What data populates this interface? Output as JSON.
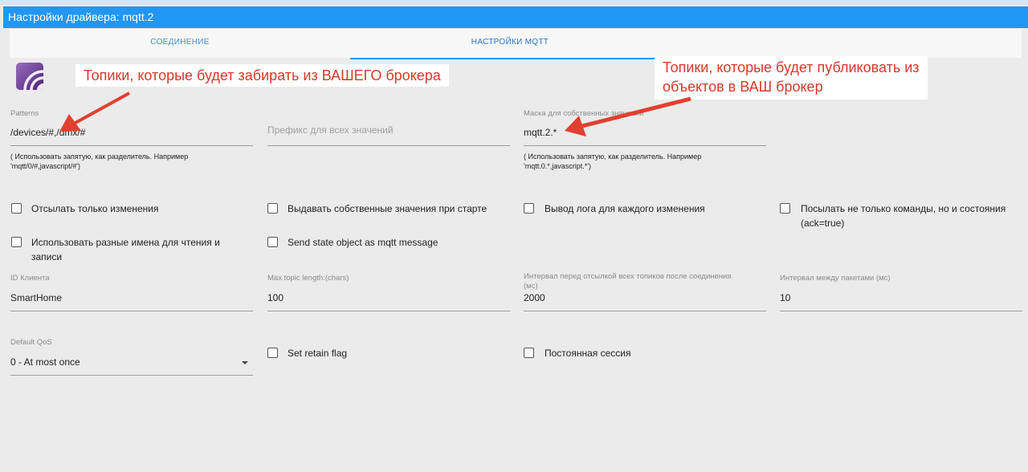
{
  "window": {
    "title": "Настройки драйвера: mqtt.2"
  },
  "tabs": [
    {
      "label": "СОЕДИНЕНИЕ",
      "active": false
    },
    {
      "label": "НАСТРОЙКИ MQTT",
      "active": true
    }
  ],
  "annotations": {
    "left": "Топики, которые будет забирать из ВАШЕГО брокера",
    "right_line1": "Топики, которые будет публиковать из",
    "right_line2": "объектов в ВАШ брокер"
  },
  "patterns": {
    "label": "Patterns",
    "value": "/devices/#,/dmx/#",
    "help_line1": "( Использовать запятую, как разделитель. Например",
    "help_line2": "'mqtt/0/#,javascript/#')"
  },
  "prefix": {
    "placeholder": "Префикс для всех значений"
  },
  "own_mask": {
    "label": "Маска для собственных значений",
    "value": "mqtt.2.*",
    "help_line1": "( Использовать запятую, как разделитель. Например",
    "help_line2": "'mqtt.0.*,javascript.*')"
  },
  "checkboxes": {
    "only_changes": "Отсылать только изменения",
    "publish_on_start": "Выдавать собственные значения при старте",
    "log_each_change": "Вывод лога для каждого изменения",
    "send_states_line1": "Посылать не только команды, но и состояния",
    "send_states_line2": "(ack=true)",
    "diff_names_line1": "Использовать разные имена для чтения и",
    "diff_names_line2": "записи",
    "send_state_object": "Send state object as mqtt message",
    "retain": "Set retain flag",
    "persistent": "Постоянная сессия"
  },
  "client_id": {
    "label": "ID Клиента",
    "value": "SmartHome"
  },
  "max_topic": {
    "label": "Max topic length:(chars)",
    "value": "100"
  },
  "interval_connect": {
    "label_line1": "Интервал перед отсылкой всех топиков после соединения",
    "label_line2": "(мс)",
    "value": "2000"
  },
  "interval_packets": {
    "label": "Интервал между пакетами (мс)",
    "value": "10"
  },
  "qos": {
    "label": "Default QoS",
    "value": "0 - At most once"
  },
  "colors": {
    "accent": "#2196f3",
    "annotation_text": "#d53a2a",
    "arrow": "#e0402f"
  }
}
